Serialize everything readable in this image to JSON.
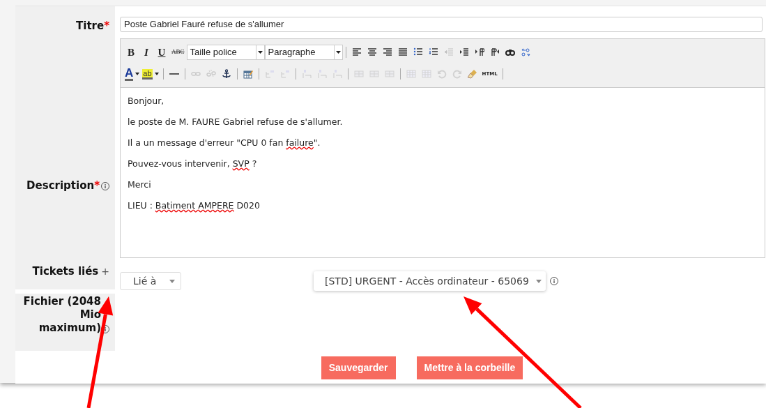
{
  "fields": [
    {
      "kind": "text",
      "label": "Titre",
      "required_mark": "*",
      "value": "Poste Gabriel Fauré refuse de s'allumer"
    },
    {
      "kind": "editor",
      "label": "Description",
      "required_mark": "*",
      "info": true,
      "toolbar": [
        [
          {
            "kind": "bold",
            "label": "B"
          },
          {
            "kind": "italic",
            "label": "I"
          },
          {
            "kind": "underline",
            "label": "U"
          },
          {
            "kind": "strike",
            "label": "ABC"
          },
          {
            "kind": "select",
            "label": "Taille police"
          },
          {
            "kind": "select",
            "label": "Paragraphe"
          },
          {
            "kind": "sep"
          },
          {
            "kind": "align-left"
          },
          {
            "kind": "align-center"
          },
          {
            "kind": "align-right"
          },
          {
            "kind": "align-justify"
          },
          {
            "kind": "bullets"
          },
          {
            "kind": "numbers"
          },
          {
            "kind": "outdent",
            "disabled": true
          },
          {
            "kind": "indent"
          },
          {
            "kind": "ltr"
          },
          {
            "kind": "rtl"
          },
          {
            "kind": "find"
          },
          {
            "kind": "replace"
          }
        ],
        [
          {
            "kind": "text-color",
            "label": "A"
          },
          {
            "kind": "highlight",
            "label": "ab"
          },
          {
            "kind": "sep"
          },
          {
            "kind": "hr"
          },
          {
            "kind": "sep"
          },
          {
            "kind": "link",
            "disabled": true
          },
          {
            "kind": "unlink",
            "disabled": true
          },
          {
            "kind": "anchor"
          },
          {
            "kind": "sep"
          },
          {
            "kind": "table"
          },
          {
            "kind": "sep"
          },
          {
            "kind": "table-row",
            "disabled": true
          },
          {
            "kind": "table-row",
            "disabled": true
          },
          {
            "kind": "sep"
          },
          {
            "kind": "table-col",
            "disabled": true
          },
          {
            "kind": "table-col",
            "disabled": true
          },
          {
            "kind": "table-col",
            "disabled": true
          },
          {
            "kind": "sep"
          },
          {
            "kind": "cell",
            "disabled": true
          },
          {
            "kind": "cell",
            "disabled": true
          },
          {
            "kind": "cell",
            "disabled": true
          },
          {
            "kind": "sep"
          },
          {
            "kind": "grid",
            "disabled": true
          },
          {
            "kind": "grid",
            "disabled": true
          },
          {
            "kind": "undo",
            "disabled": true
          },
          {
            "kind": "redo",
            "disabled": true
          },
          {
            "kind": "clean"
          },
          {
            "kind": "html",
            "label": "HTML"
          },
          {
            "kind": "sep"
          }
        ]
      ],
      "lines": [
        {
          "text": "Bonjour,"
        },
        {
          "text": "le poste de M. FAURE Gabriel refuse de s'allumer."
        },
        {
          "text": "Il a un message d'erreur \"CPU 0 fan ",
          "misspelled": "failure",
          "after": "\"."
        },
        {
          "text": "Pouvez-vous intervenir, ",
          "misspelled": "SVP",
          "after": " ?"
        },
        {
          "text": "Merci"
        },
        {
          "text": "LIEU : ",
          "misspelled": "Batiment AMPERE",
          "after": " D020"
        }
      ]
    },
    {
      "kind": "links",
      "label": "Tickets liés",
      "add": "+",
      "relation": "Lié à",
      "ticket": "[STD] URGENT - Accès ordinateur - 65069",
      "info": true
    },
    {
      "kind": "file",
      "label": "Fichier (2048 Mio maximum)",
      "info": true
    }
  ],
  "buttons": [
    "Sauvegarder",
    "Mettre à la corbeille"
  ],
  "annotations": [
    {
      "kind": "arrow"
    },
    {
      "kind": "arrow"
    }
  ]
}
